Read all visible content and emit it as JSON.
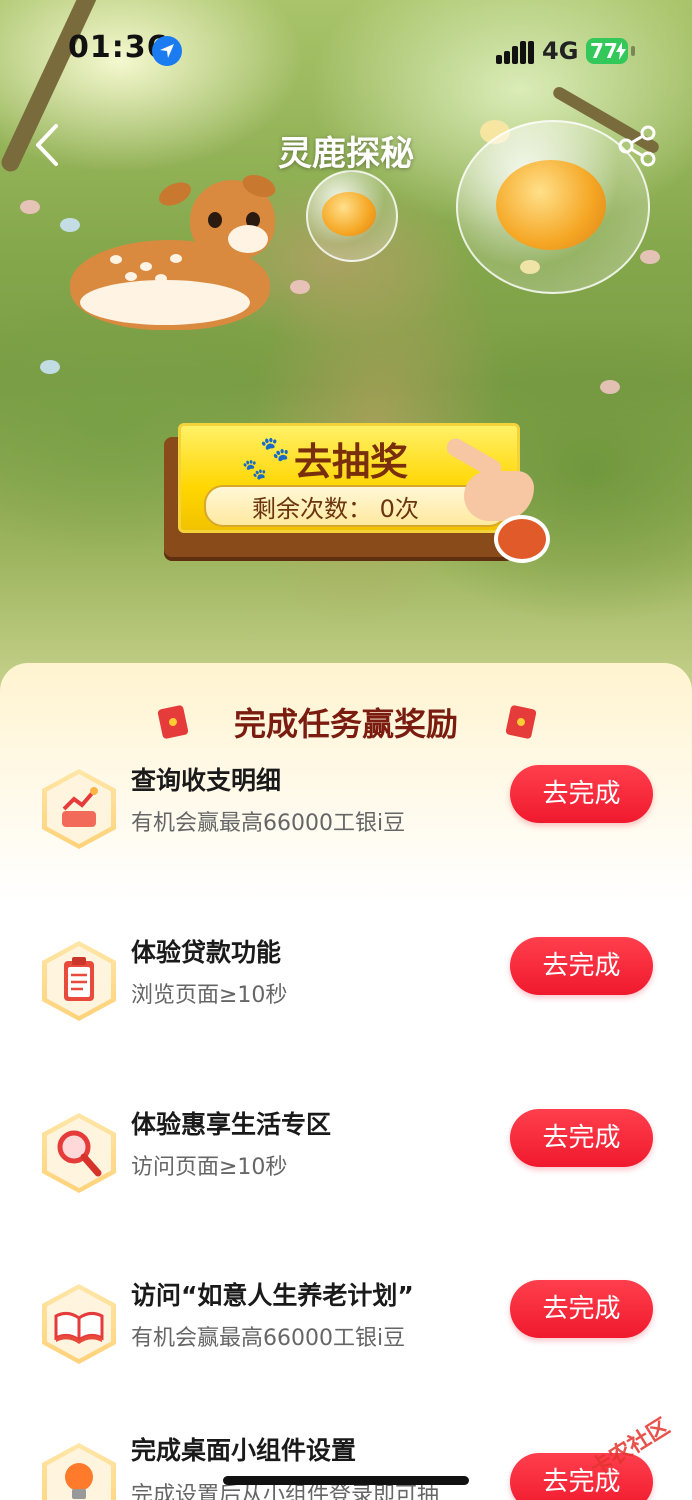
{
  "status_bar": {
    "time": "01:36",
    "network": "4G",
    "battery": "77"
  },
  "header": {
    "title": "灵鹿探秘"
  },
  "lottery": {
    "label": "去抽奖",
    "remaining": "剩余次数： 0次"
  },
  "tasks_section": {
    "title": "完成任务赢奖励",
    "items": [
      {
        "name": "查询收支明细",
        "desc": "有机会赢最高66000工银i豆",
        "action": "去完成",
        "icon": "chart-icon"
      },
      {
        "name": "体验贷款功能",
        "desc": "浏览页面≥10秒",
        "action": "去完成",
        "icon": "clipboard-icon"
      },
      {
        "name": "体验惠享生活专区",
        "desc": "访问页面≥10秒",
        "action": "去完成",
        "icon": "magnifier-icon"
      },
      {
        "name": "访问“如意人生养老计划”",
        "desc": "有机会赢最高66000工银i豆",
        "action": "去完成",
        "icon": "book-icon"
      },
      {
        "name": "完成桌面小组件设置",
        "desc": "完成设置后从小组件登录即可抽",
        "action": "去完成",
        "icon": "lightbulb-icon"
      }
    ]
  },
  "watermark": "卡农社区",
  "colors": {
    "accent": "#f0192e",
    "title": "#7a1d10",
    "battery": "#34c759"
  }
}
